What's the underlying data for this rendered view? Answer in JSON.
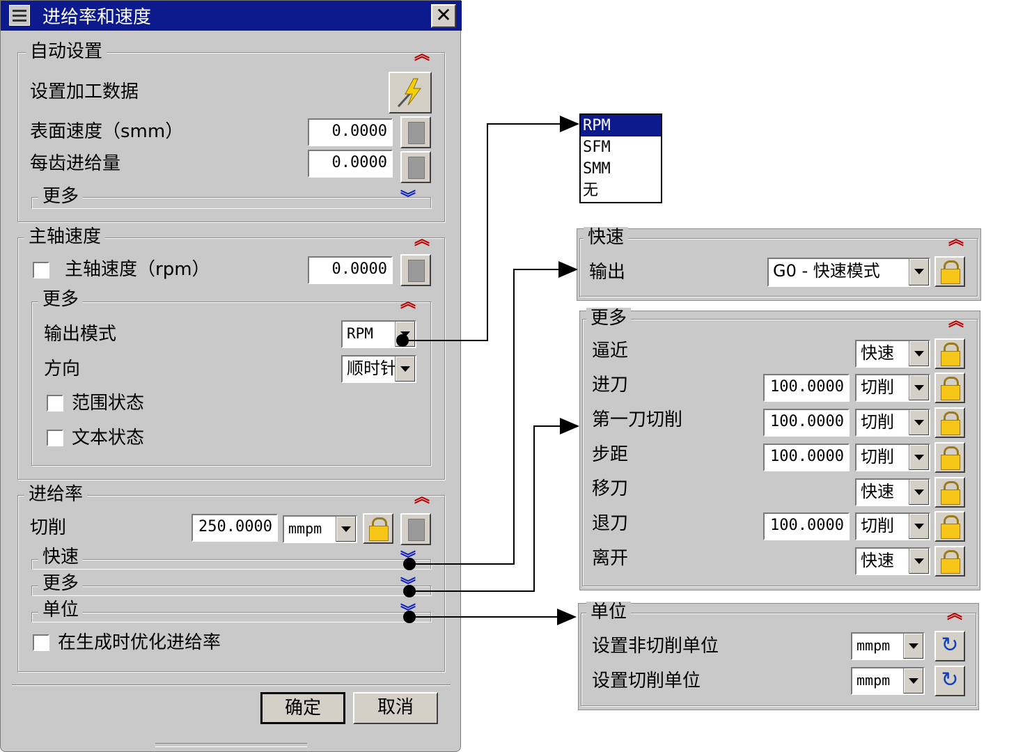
{
  "dialog": {
    "title": "进给率和速度",
    "auto_settings": {
      "title": "自动设置",
      "set_machining_data": "设置加工数据",
      "surface_speed_label": "表面速度（smm）",
      "surface_speed_value": "0.0000",
      "feed_per_tooth_label": "每齿进给量",
      "feed_per_tooth_value": "0.0000",
      "more_label": "更多"
    },
    "spindle": {
      "title": "主轴速度",
      "spindle_speed_label": "主轴速度（rpm）",
      "spindle_speed_value": "0.0000",
      "more_title": "更多",
      "output_mode_label": "输出模式",
      "output_mode_value": "RPM",
      "direction_label": "方向",
      "direction_value": "顺时针",
      "range_status_label": "范围状态",
      "text_status_label": "文本状态"
    },
    "feed": {
      "title": "进给率",
      "cut_label": "切削",
      "cut_value": "250.0000",
      "cut_unit": "mmpm",
      "rapid_label": "快速",
      "more_label": "更多",
      "units_label": "单位",
      "optimize_label": "在生成时优化进给率"
    },
    "ok_label": "确定",
    "cancel_label": "取消"
  },
  "output_mode_list": {
    "options": [
      "RPM",
      "SFM",
      "SMM",
      "无"
    ],
    "selected": "RPM"
  },
  "rapid_panel": {
    "title": "快速",
    "output_label": "输出",
    "output_value": "G0 - 快速模式"
  },
  "more_panel": {
    "title": "更多",
    "rows": [
      {
        "label": "逼近",
        "value": "",
        "mode": "快速"
      },
      {
        "label": "进刀",
        "value": "100.0000",
        "mode": "切削"
      },
      {
        "label": "第一刀切削",
        "value": "100.0000",
        "mode": "切削"
      },
      {
        "label": "步距",
        "value": "100.0000",
        "mode": "切削"
      },
      {
        "label": "移刀",
        "value": "",
        "mode": "快速"
      },
      {
        "label": "退刀",
        "value": "100.0000",
        "mode": "切削"
      },
      {
        "label": "离开",
        "value": "",
        "mode": "快速"
      }
    ]
  },
  "units_panel": {
    "title": "单位",
    "non_cut_label": "设置非切削单位",
    "non_cut_value": "mmpm",
    "cut_label": "设置切削单位",
    "cut_value": "mmpm"
  }
}
